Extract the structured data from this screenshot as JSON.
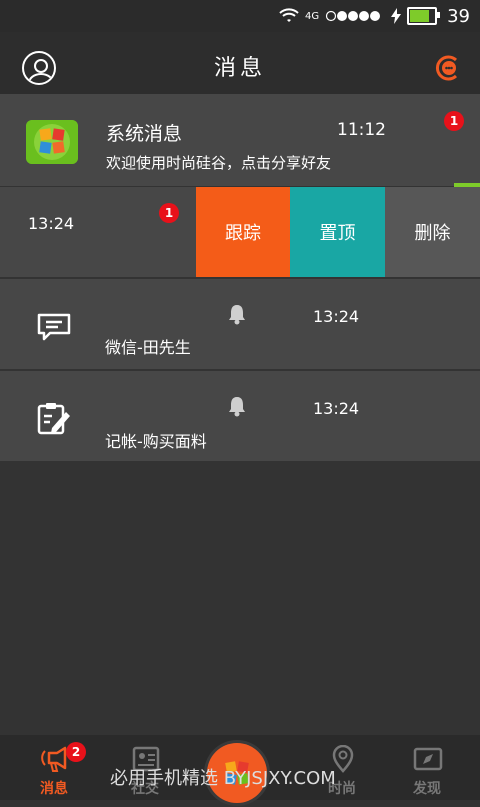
{
  "status_bar": {
    "network": "4G",
    "battery_level": "39",
    "battery_fill": 0.85
  },
  "header": {
    "title": "消息"
  },
  "messages": [
    {
      "title": "系统消息",
      "time": "11:12",
      "preview": "欢迎使用时尚硅谷，点击分享好友",
      "badge": "1"
    },
    {
      "time": "13:24",
      "badge": "1"
    },
    {
      "title": "微信-田先生",
      "time": "13:24"
    },
    {
      "title": "记帐-购买面料",
      "time": "13:24"
    }
  ],
  "swipe_actions": {
    "track": "跟踪",
    "pin": "置顶",
    "delete": "删除"
  },
  "tabs": [
    {
      "label": "消息",
      "badge": "2",
      "active": true
    },
    {
      "label": "社交"
    },
    {
      "label": "时尚"
    },
    {
      "label": "发现"
    }
  ],
  "watermark": "必用手机精选 BYJSJXY.COM",
  "colors": {
    "accent": "#f15a22",
    "teal": "#19a7a4",
    "green": "#7ecb2a",
    "badge": "#e8111a"
  }
}
